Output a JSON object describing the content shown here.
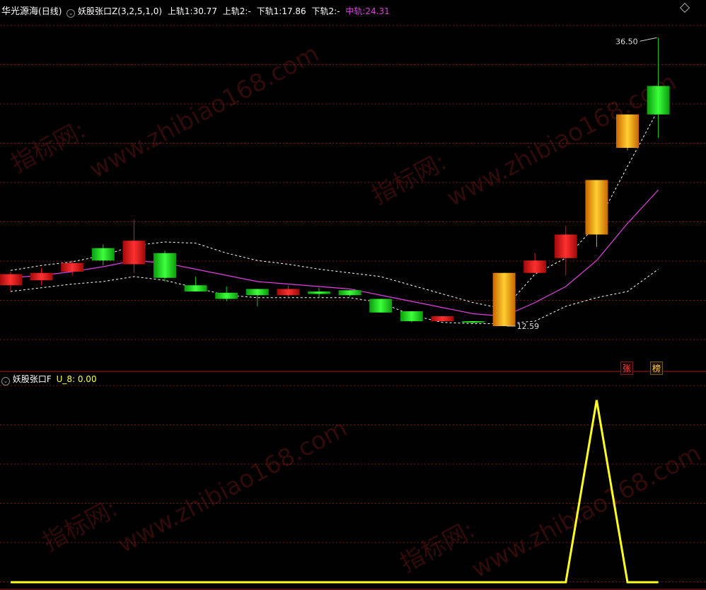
{
  "header": {
    "stock_name": "华光源海",
    "period": "(日线)",
    "indicator": "妖股张口Z",
    "params": "(3,2,5,1,0)",
    "up1_label": "上轨1:",
    "up1_value": "30.77",
    "up2_label": "上轨2:",
    "up2_value": "-",
    "down1_label": "下轨1:",
    "down1_value": "17.86",
    "down2_label": "下轨2:",
    "down2_value": "-",
    "mid_label": "中轨:",
    "mid_value": "24.31"
  },
  "sub_header": {
    "indicator": "妖股张口F",
    "series_label": "U_8:",
    "series_value": "0.00"
  },
  "watermark": {
    "url": "www.zhibiao168.com",
    "site": "指标网:"
  },
  "markers": {
    "zhang": "张",
    "bang": "榜"
  },
  "colors": {
    "background": "#000000",
    "grid": "#7a1a1a",
    "up_candle": "#e01818",
    "down_candle": "#10d010",
    "limit_up_candle": "#f0a000",
    "mid_line": "#e040e0",
    "band_line": "#ffffff",
    "sub_line": "#ffff20",
    "header_text": "#ffffff",
    "value_text": "#ffff50",
    "mid_text": "#e040e0"
  },
  "chart_data": [
    {
      "type": "candlestick",
      "title": "妖股张口Z",
      "ylim": [
        10.5,
        38.5
      ],
      "max_label": "36.50",
      "min_label": "12.59",
      "candles": [
        {
          "o": 16.6,
          "h": 17.7,
          "l": 16.1,
          "c": 17.5,
          "style": "up"
        },
        {
          "o": 17.0,
          "h": 18.0,
          "l": 16.6,
          "c": 17.6,
          "style": "up"
        },
        {
          "o": 17.7,
          "h": 18.6,
          "l": 17.4,
          "c": 18.4,
          "style": "up"
        },
        {
          "o": 19.6,
          "h": 19.9,
          "l": 18.2,
          "c": 18.6,
          "style": "down"
        },
        {
          "o": 18.3,
          "h": 21.9,
          "l": 17.6,
          "c": 20.2,
          "style": "up"
        },
        {
          "o": 19.2,
          "h": 19.4,
          "l": 16.9,
          "c": 17.2,
          "style": "down"
        },
        {
          "o": 16.6,
          "h": 17.3,
          "l": 16.1,
          "c": 16.1,
          "style": "down"
        },
        {
          "o": 16.0,
          "h": 16.5,
          "l": 15.3,
          "c": 15.5,
          "style": "down"
        },
        {
          "o": 16.3,
          "h": 16.3,
          "l": 14.9,
          "c": 15.8,
          "style": "down"
        },
        {
          "o": 15.8,
          "h": 16.6,
          "l": 15.6,
          "c": 16.3,
          "style": "up"
        },
        {
          "o": 16.1,
          "h": 16.4,
          "l": 15.6,
          "c": 15.9,
          "style": "down"
        },
        {
          "o": 16.2,
          "h": 16.2,
          "l": 15.7,
          "c": 15.8,
          "style": "down"
        },
        {
          "o": 15.5,
          "h": 15.5,
          "l": 14.4,
          "c": 14.4,
          "style": "down"
        },
        {
          "o": 14.5,
          "h": 14.5,
          "l": 13.6,
          "c": 13.7,
          "style": "down"
        },
        {
          "o": 14.1,
          "h": 14.1,
          "l": 13.7,
          "c": 13.7,
          "style": "up"
        },
        {
          "o": 13.7,
          "h": 13.7,
          "l": 13.5,
          "c": 13.6,
          "style": "down"
        },
        {
          "o": 13.3,
          "h": 17.6,
          "l": 13.3,
          "c": 17.6,
          "style": "limit"
        },
        {
          "o": 17.6,
          "h": 19.2,
          "l": 17.6,
          "c": 18.6,
          "style": "up"
        },
        {
          "o": 18.8,
          "h": 21.4,
          "l": 17.4,
          "c": 20.7,
          "style": "up"
        },
        {
          "o": 20.7,
          "h": 25.1,
          "l": 19.7,
          "c": 25.1,
          "style": "limit"
        },
        {
          "o": 27.7,
          "h": 30.4,
          "l": 27.5,
          "c": 30.4,
          "style": "limit"
        },
        {
          "o": 30.4,
          "h": 36.6,
          "l": 28.5,
          "c": 32.7,
          "style": "down"
        }
      ],
      "series": [
        {
          "name": "中轨",
          "values": [
            17.2,
            17.4,
            17.7,
            18.1,
            18.6,
            18.4,
            17.9,
            17.4,
            16.9,
            16.7,
            16.5,
            16.3,
            15.8,
            15.3,
            14.8,
            14.3,
            14.1,
            15.2,
            16.5,
            18.6,
            21.6,
            24.3
          ]
        },
        {
          "name": "上轨1",
          "values": [
            17.8,
            18.2,
            18.5,
            19.0,
            19.8,
            20.1,
            20.0,
            19.2,
            18.6,
            18.3,
            17.9,
            17.6,
            17.3,
            16.6,
            15.9,
            15.2,
            14.7,
            17.5,
            18.8,
            21.5,
            26.2,
            30.8
          ]
        },
        {
          "name": "下轨1",
          "values": [
            16.1,
            16.4,
            16.7,
            16.9,
            17.3,
            17.0,
            16.4,
            15.8,
            15.6,
            15.6,
            15.6,
            15.6,
            15.2,
            14.2,
            13.6,
            13.5,
            13.5,
            13.7,
            14.9,
            15.6,
            16.1,
            17.9
          ]
        }
      ]
    },
    {
      "type": "line",
      "title": "妖股张口F",
      "ylim": [
        0,
        1.08
      ],
      "series": [
        {
          "name": "U_8",
          "values": [
            0,
            0,
            0,
            0,
            0,
            0,
            0,
            0,
            0,
            0,
            0,
            0,
            0,
            0,
            0,
            0,
            0,
            0,
            0,
            1,
            0,
            0
          ]
        }
      ]
    }
  ]
}
